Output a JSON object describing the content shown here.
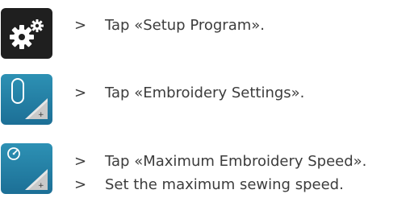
{
  "steps": [
    {
      "icon": "setup-gear-icon",
      "marker": ">",
      "text": "Tap «Setup Program»."
    },
    {
      "icon": "embroidery-hoop-icon",
      "marker": ">",
      "text": "Tap «Embroidery Settings»."
    },
    {
      "icon": "speedometer-icon",
      "marker": ">",
      "text": "Tap «Maximum Embroidery Speed»."
    },
    {
      "marker": ">",
      "text": "Set the maximum sewing speed."
    }
  ],
  "colors": {
    "icon_dark": "#1f1f1f",
    "icon_blue": "#2386ac",
    "text": "#3c3c3c"
  }
}
